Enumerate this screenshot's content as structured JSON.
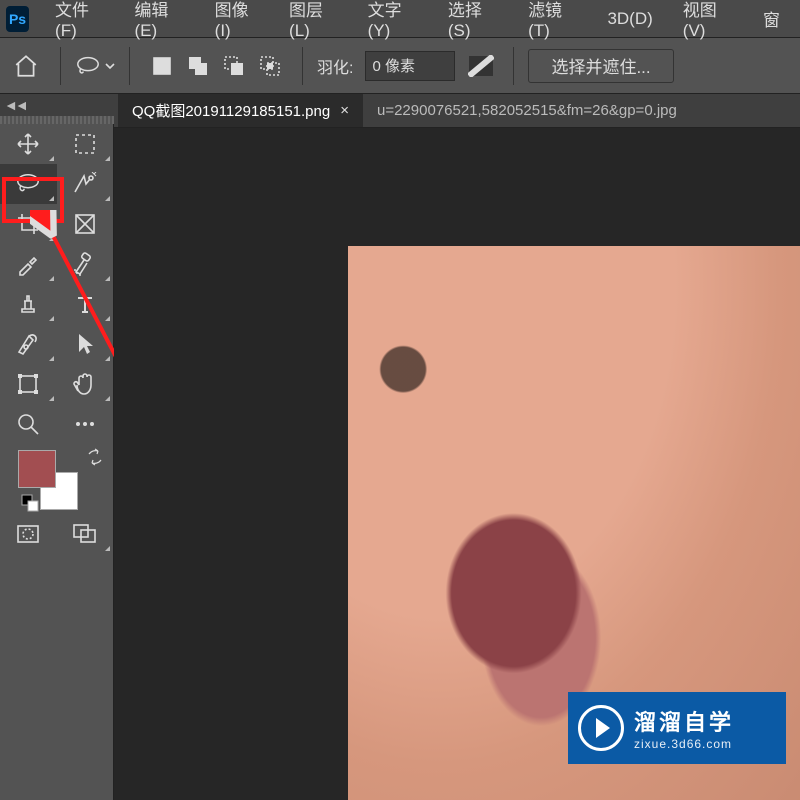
{
  "app": {
    "logo": "Ps"
  },
  "menu": {
    "file": "文件(F)",
    "edit": "编辑(E)",
    "image": "图像(I)",
    "layer": "图层(L)",
    "type": "文字(Y)",
    "select": "选择(S)",
    "filter": "滤镜(T)",
    "threeD": "3D(D)",
    "view": "视图(V)",
    "window": "窗"
  },
  "options": {
    "feather_label": "羽化:",
    "feather_value": "0 像素",
    "select_and_mask": "选择并遮住..."
  },
  "tabs": {
    "active": "QQ截图20191129185151.png",
    "inactive": "u=2290076521,582052515&fm=26&gp=0.jpg"
  },
  "swatches": {
    "foreground": "#a24e51",
    "background": "#ffffff"
  },
  "watermark": {
    "title": "溜溜自学",
    "sub": "zixue.3d66.com"
  }
}
